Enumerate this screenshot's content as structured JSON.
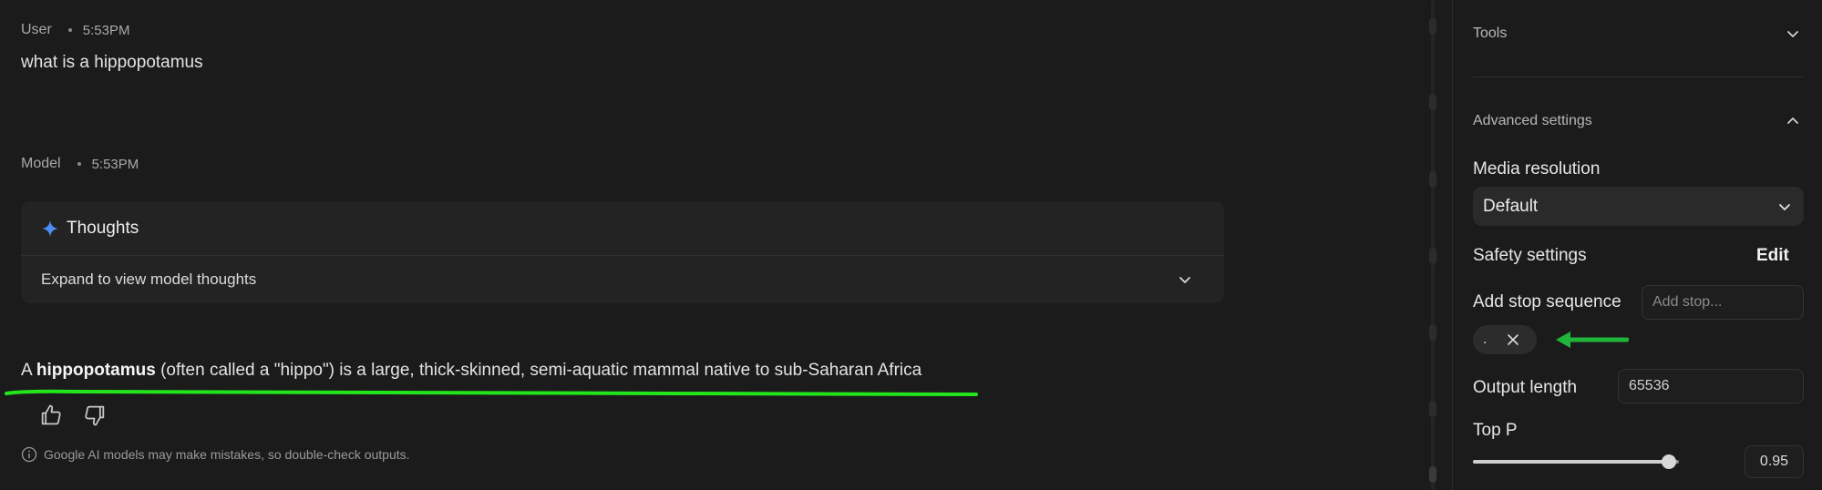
{
  "chat": {
    "user_turn": {
      "role": "User",
      "time": "5:53PM",
      "text": "what is a hippopotamus"
    },
    "model_turn": {
      "role": "Model",
      "time": "5:53PM"
    },
    "thoughts": {
      "title": "Thoughts",
      "expand_label": "Expand to view model thoughts"
    },
    "answer": {
      "prefix": "A ",
      "bold": "hippopotamus",
      "suffix": " (often called a \"hippo\") is a large, thick-skinned, semi-aquatic mammal native to sub-Saharan Africa"
    },
    "disclaimer": "Google AI models may make mistakes, so double-check outputs.",
    "annotation_color": "#22e51b"
  },
  "panel": {
    "tools_label": "Tools",
    "advanced_label": "Advanced settings",
    "media_resolution": {
      "label": "Media resolution",
      "value": "Default"
    },
    "safety": {
      "label": "Safety settings",
      "edit_label": "Edit"
    },
    "stop_sequence": {
      "label": "Add stop sequence",
      "placeholder": "Add stop...",
      "chip_value": "."
    },
    "output_length": {
      "label": "Output length",
      "value": "65536"
    },
    "top_p": {
      "label": "Top P",
      "value": "0.95",
      "fraction": 0.95
    },
    "annotation_color": "#1fb53a"
  }
}
